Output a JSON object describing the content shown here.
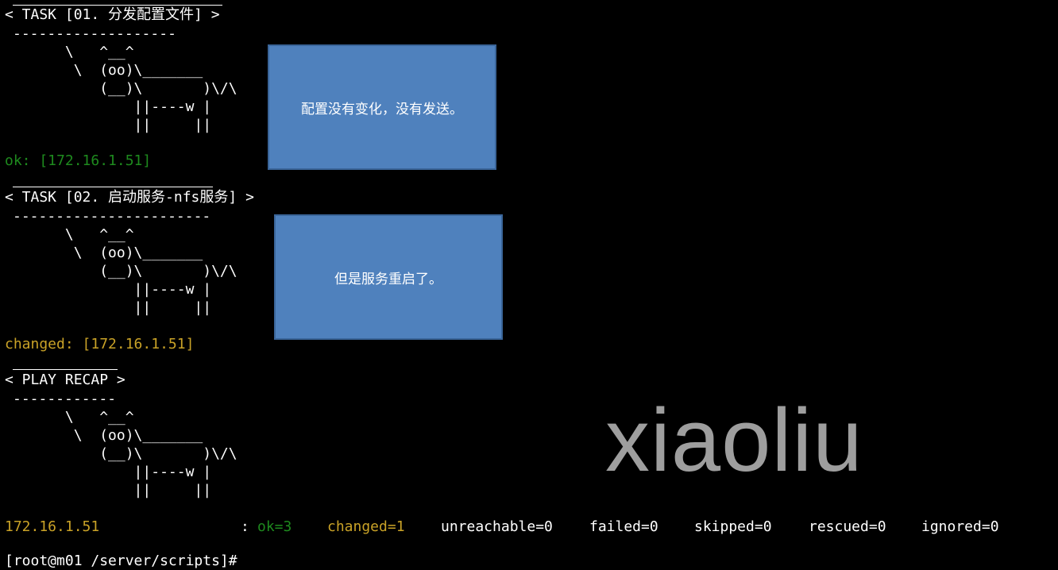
{
  "task1": {
    "header": "< TASK [01. 分发配置文件] >",
    "dashes": "-------------------",
    "result": "ok: [172.16.1.51]",
    "callout": "配置没有变化，没有发送。"
  },
  "task2": {
    "header": "< TASK [02. 启动服务-nfs服务] >",
    "dashes": "-----------------------",
    "result": "changed: [172.16.1.51]",
    "callout": "但是服务重启了。"
  },
  "recap": {
    "header": "< PLAY RECAP >",
    "dashes": "------------",
    "host": "172.16.1.51",
    "colon": ":",
    "ok": "ok=3",
    "changed": "changed=1",
    "unreachable": "unreachable=0",
    "failed": "failed=0",
    "skipped": "skipped=0",
    "rescued": "rescued=0",
    "ignored": "ignored=0"
  },
  "cow": "       \\   ^__^\n        \\  (oo)\\_______\n           (__)\\       )\\/\\\n               ||----w |\n               ||     ||",
  "watermark": "xiaoliu",
  "prompt": "[root@m01 /server/scripts]#",
  "colors": {
    "background": "#000000",
    "ok": "#1e8a1e",
    "changed": "#c9a227",
    "callout_bg": "#4f81bd",
    "watermark": "#9e9e9e"
  }
}
